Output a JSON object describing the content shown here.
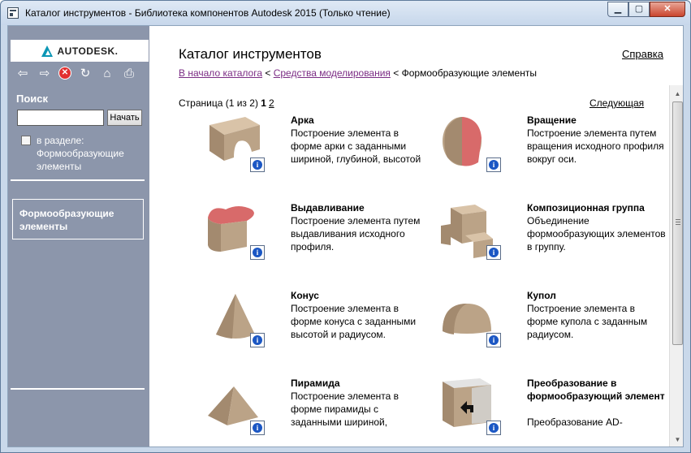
{
  "window": {
    "title": "Каталог инструментов - Библиотека компонентов Autodesk 2015 (Только чтение)",
    "min_glyph": "▁",
    "max_glyph": "▢",
    "close_glyph": "✕"
  },
  "sidebar": {
    "logo_text": "AUTODESK.",
    "toolbar": {
      "back_glyph": "⇦",
      "forward_glyph": "⇨",
      "stop_glyph": "✕",
      "refresh_glyph": "↻",
      "home_glyph": "⌂",
      "print_glyph": "⎙"
    },
    "search_title": "Поиск",
    "search_value": "",
    "search_button": "Начать",
    "scope_label": "в разделе: Формообразующие элементы",
    "category": "Формообразующие элементы"
  },
  "main": {
    "heading": "Каталог инструментов",
    "help": "Справка",
    "breadcrumb": {
      "home": "В начало каталога",
      "sep1": " < ",
      "modeling": "Средства моделирования",
      "sep2": " < ",
      "current": "Формообразующие элементы"
    },
    "page_info": {
      "prefix": "Страница (1 из 2) ",
      "current": "1",
      "other": "2"
    },
    "next": "Следующая",
    "tools": [
      {
        "name": "Арка",
        "desc": "Построение элемента в форме арки с заданными шириной, глубиной, высотой"
      },
      {
        "name": "Вращение",
        "desc": "Построение элемента путем вращения исходного профиля вокруг оси."
      },
      {
        "name": "Выдавливание",
        "desc": "Построение элемента путем выдавливания исходного профиля."
      },
      {
        "name": "Композиционная группа",
        "desc": "Объединение формообразующих элементов в группу."
      },
      {
        "name": "Конус",
        "desc": "Построение элемента в форме конуса с заданными высотой и радиусом."
      },
      {
        "name": "Купол",
        "desc": "Построение элемента в форме купола с заданным радиусом."
      },
      {
        "name": "Пирамида",
        "desc": "Построение элемента в форме пирамиды с заданными шириной,"
      },
      {
        "name": "Преобразование в формообразующий элемент",
        "desc": "Преобразование AD-"
      }
    ],
    "info_glyph": "i"
  }
}
